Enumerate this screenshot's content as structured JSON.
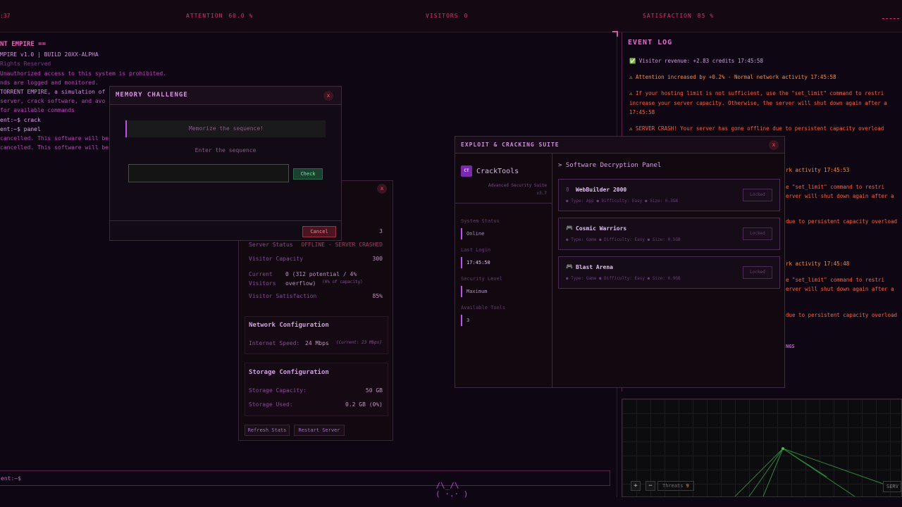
{
  "topbar": {
    "clock": ":37",
    "attention_label": "ATTENTION",
    "attention_value": "60.0 %",
    "visitors_label": "VISITORS",
    "visitors_value": "0",
    "satisfaction_label": "SATISFACTION",
    "satisfaction_value": "85 %"
  },
  "terminal": {
    "lines": [
      "NT EMPIRE ==",
      "MPIRE v1.0 | BUILD 20XX-ALPHA",
      "Rights Reserved",
      "Unauthorized access to this system is prohibited.",
      "nds are logged and monitored.",
      "TORRENT EMPIRE, a simulation of",
      "server, crack software, and avo",
      "for available commands",
      "ent:~$  crack",
      "ent:~$  panel",
      "cancelled. This software will be",
      "cancelled. This software will be"
    ],
    "prompt": "ent:~$",
    "mascot": "/\\_/\\\n( ·.· )"
  },
  "memory_modal": {
    "title": "MEMORY CHALLENGE",
    "close": "x",
    "sequence_text": "Memorize the sequence!",
    "prompt": "Enter the sequence",
    "input_value": "",
    "check_label": "Check",
    "cancel_label": "Cancel"
  },
  "server_panel": {
    "close": "x",
    "count_value": "3",
    "status_label": "Server Status",
    "status_value": "OFFLINE - SERVER CRASHED",
    "capacity_label": "Visitor Capacity",
    "capacity_value": "300",
    "current_label": "Current Visitors",
    "current_value": "0 (312 potential / 4% overflow)",
    "current_note": "(0% of capacity)",
    "satisfaction_label": "Visitor Satisfaction",
    "satisfaction_value": "85%",
    "network_title": "Network Configuration",
    "speed_label": "Internet Speed:",
    "speed_value": "24 Mbps",
    "speed_current": "(Current: 23 Mbps)",
    "storage_title": "Storage Configuration",
    "storage_cap_label": "Storage Capacity:",
    "storage_cap_value": "50 GB",
    "storage_used_label": "Storage Used:",
    "storage_used_value": "0.2 GB (0%)",
    "refresh_label": "Refresh Stats",
    "restart_label": "Restart Server"
  },
  "crack_suite": {
    "title": "EXPLOIT & CRACKING SUITE",
    "close": "x",
    "logo": "CT",
    "brand": "CrackTools",
    "subtitle": "Advanced Security Suite v3.7",
    "system_status_label": "System Status",
    "system_status_value": "Online",
    "last_login_label": "Last Login",
    "last_login_value": "17:45:50",
    "security_label": "Security Level",
    "security_value": "Maximum",
    "tools_label": "Available Tools",
    "tools_value": "3",
    "panel_title": "> Software Decryption Panel",
    "cards": [
      {
        "icon": "▯",
        "name": "WebBuilder 2000",
        "meta": "● Type: App   ● Difficulty: Easy   ● Size: 0.3GB",
        "lock": "Locked"
      },
      {
        "icon": "🎮",
        "name": "Cosmic Warriors",
        "meta": "● Type: Game   ● Difficulty: Easy   ● Size: 0.5GB",
        "lock": "Locked"
      },
      {
        "icon": "🎮",
        "name": "Blast Arena",
        "meta": "● Type: Game   ● Difficulty: Easy   ● Size: 0.9GB",
        "lock": "Locked"
      }
    ]
  },
  "event_log": {
    "title": "EVENT LOG",
    "events": [
      {
        "icon": "✅",
        "text": "Visitor revenue: +2.83 credits 17:45:58",
        "color": "#d0a0e0"
      },
      {
        "icon": "⚠",
        "text": "Attention increased by +0.2% - Normal network activity 17:45:58",
        "color": "#ff8a40"
      },
      {
        "icon": "⚠",
        "text": "If your hosting limit is not sufficient, use the \"set_limit\" command to restri",
        "color": "#ff6040"
      },
      {
        "icon": "⚠",
        "text": "SERVER CRASH! Your server has gone offline due to persistent capacity overload",
        "color": "#ff6040"
      }
    ],
    "cont_lines": [
      "increase your server capacity. Otherwise, the server will shut down again after a",
      "17:45:58"
    ],
    "right_fragments": [
      "rk activity 17:45:53",
      "e \"set_limit\" command to restri",
      "erver will shut down again after a",
      "due to persistent capacity overload",
      "rk activity 17:45:48",
      "e \"set_limit\" command to restri",
      "erver will shut down again after a",
      "due to persistent capacity overload",
      "NGS"
    ]
  },
  "map": {
    "plus": "+",
    "minus": "−",
    "threats_label": "Threats",
    "threats_value": "9",
    "serv_label": "SERV"
  }
}
